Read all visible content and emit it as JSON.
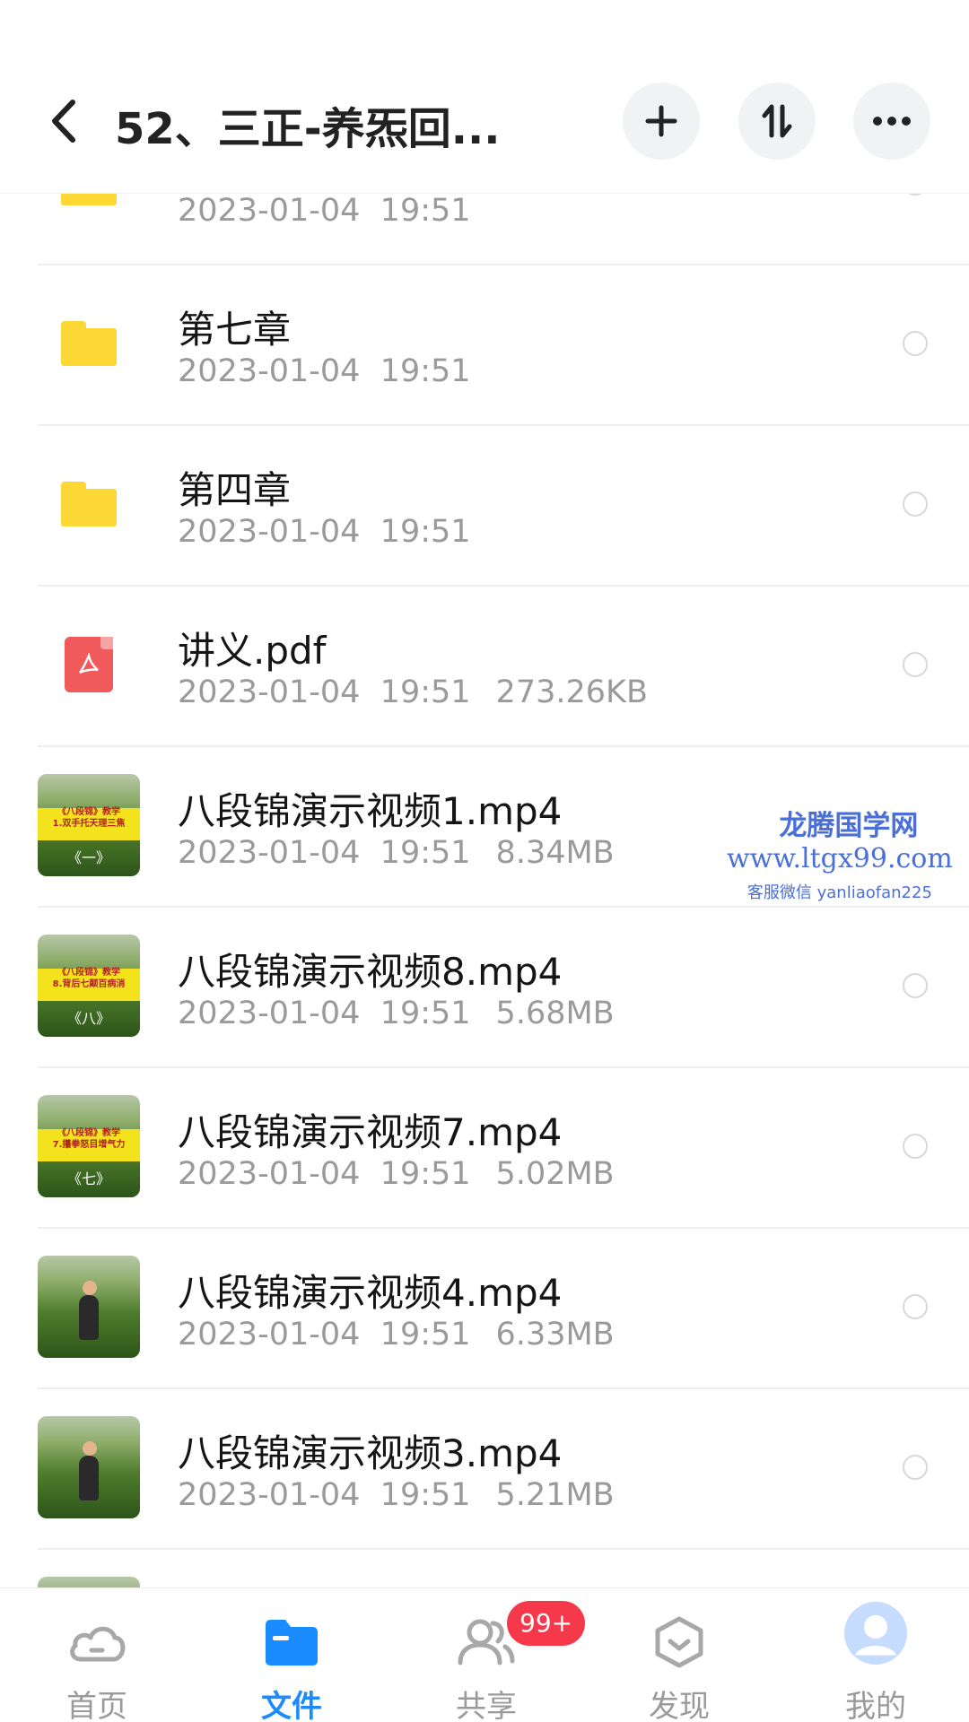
{
  "header": {
    "title": "52、三正-养炁回...",
    "back_icon": "chevron-left-icon",
    "actions": [
      "plus-icon",
      "sort-icon",
      "more-icon"
    ]
  },
  "files": [
    {
      "name": "",
      "date": "2023-01-04",
      "time": "19:51",
      "size": "",
      "type": "folder"
    },
    {
      "name": "第七章",
      "date": "2023-01-04",
      "time": "19:51",
      "size": "",
      "type": "folder"
    },
    {
      "name": "第四章",
      "date": "2023-01-04",
      "time": "19:51",
      "size": "",
      "type": "folder"
    },
    {
      "name": "讲义.pdf",
      "date": "2023-01-04",
      "time": "19:51",
      "size": "273.26KB",
      "type": "pdf"
    },
    {
      "name": "八段锦演示视频1.mp4",
      "date": "2023-01-04",
      "time": "19:51",
      "size": "8.34MB",
      "type": "video",
      "thumb_title": "《八段锦》教学",
      "thumb_sub": "1.双手托天理三焦",
      "thumb_num": "《一》"
    },
    {
      "name": "八段锦演示视频8.mp4",
      "date": "2023-01-04",
      "time": "19:51",
      "size": "5.68MB",
      "type": "video",
      "thumb_title": "《八段锦》教学",
      "thumb_sub": "8.背后七颠百病消",
      "thumb_num": "《八》"
    },
    {
      "name": "八段锦演示视频7.mp4",
      "date": "2023-01-04",
      "time": "19:51",
      "size": "5.02MB",
      "type": "video",
      "thumb_title": "《八段锦》教学",
      "thumb_sub": "7.攥拳怒目增气力",
      "thumb_num": "《七》"
    },
    {
      "name": "八段锦演示视频4.mp4",
      "date": "2023-01-04",
      "time": "19:51",
      "size": "6.33MB",
      "type": "video-person"
    },
    {
      "name": "八段锦演示视频3.mp4",
      "date": "2023-01-04",
      "time": "19:51",
      "size": "5.21MB",
      "type": "video-person"
    }
  ],
  "watermark": {
    "line1": "龙腾国学网",
    "line2": "www.ltgx99.com",
    "line3": "客服微信 yanliaofan225"
  },
  "nav": {
    "items": [
      {
        "label": "首页",
        "icon": "cloud-icon"
      },
      {
        "label": "文件",
        "icon": "folder-icon"
      },
      {
        "label": "共享",
        "icon": "people-icon"
      },
      {
        "label": "发现",
        "icon": "discover-icon"
      },
      {
        "label": "我的",
        "icon": "avatar-icon"
      }
    ],
    "active_index": 1,
    "share_badge": "99+"
  },
  "colors": {
    "accent": "#1a8cff",
    "folder": "#fdd835",
    "pdf": "#f05a5a",
    "badge": "#f5384a"
  }
}
